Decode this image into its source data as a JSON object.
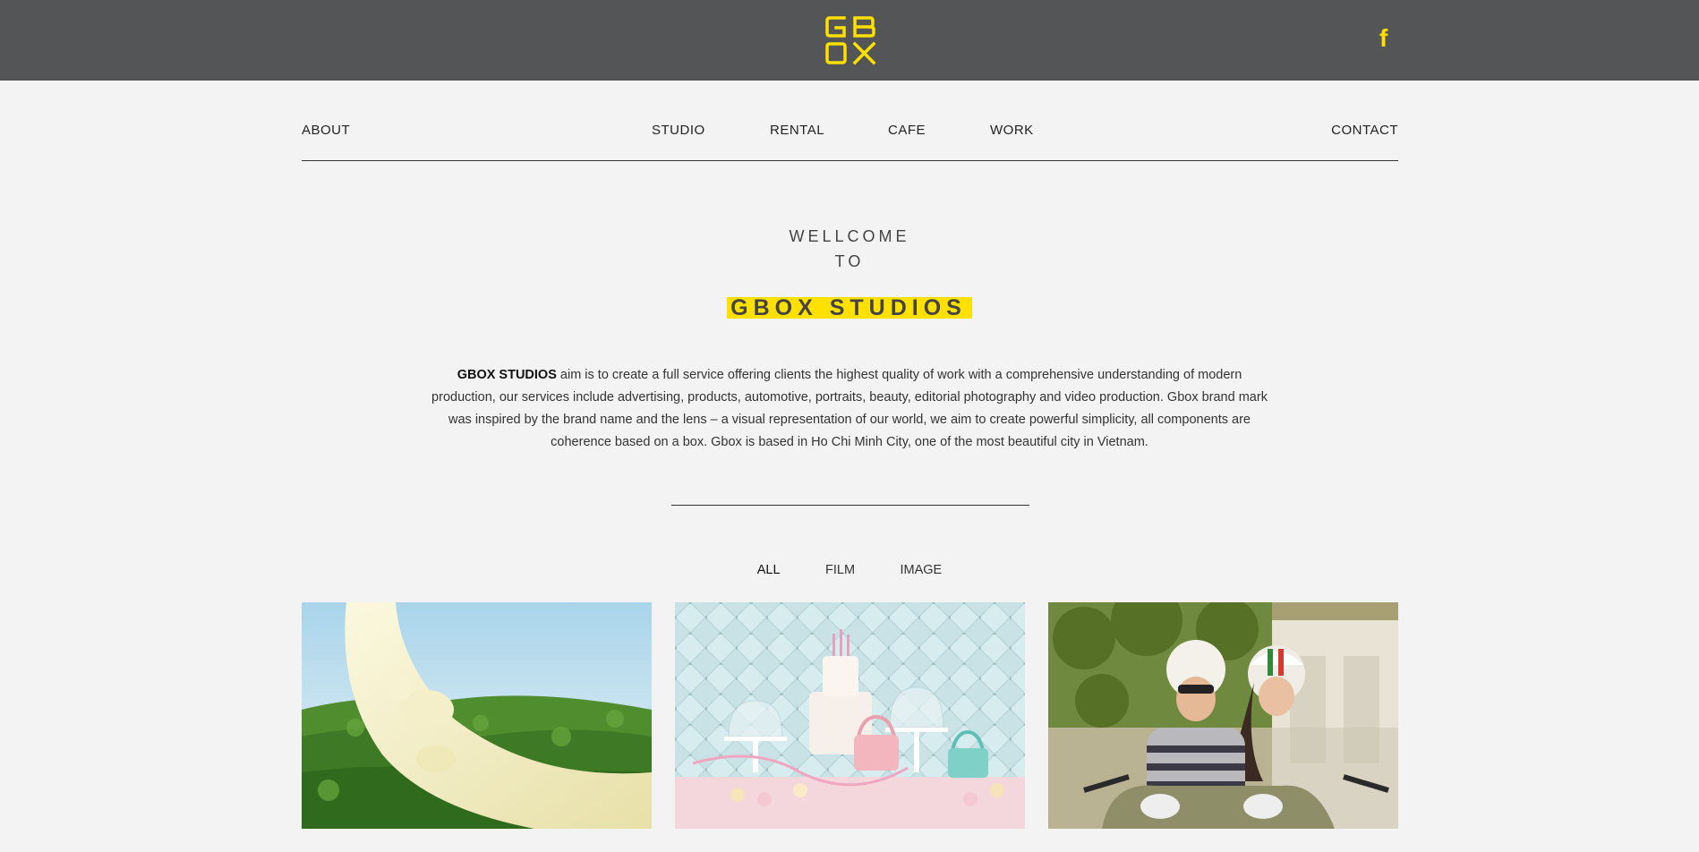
{
  "header": {
    "logo_text": "GB OX",
    "logo_color": "#ffe000",
    "background": "#545557",
    "social_icon": "facebook-icon"
  },
  "nav": {
    "about": "ABOUT",
    "studio": "STUDIO",
    "rental": "RENTAL",
    "cafe": "CAFE",
    "work": "WORK",
    "contact": "CONTACT"
  },
  "hero": {
    "line1": "WELLCOME",
    "line2": "TO",
    "brand": "GBOX STUDIOS",
    "highlight_color": "#ffe000",
    "description_lead": "GBOX STUDIOS",
    "description": " aim is to create a full service offering clients the highest quality of work with a comprehensive understanding of modern production, our services include advertising, products, automotive, portraits, beauty, editorial photography and video production. Gbox brand mark was inspired by the brand name and the lens – a visual representation of our world, we aim to create powerful simplicity, all components are coherence based on a box. Gbox is based in Ho Chi Minh City, one of the most beautiful city in Vietnam."
  },
  "filters": {
    "all": "ALL",
    "film": "FILM",
    "image": "IMAGE",
    "active": "ALL"
  },
  "portfolio": [
    {
      "subject": "milk splash over green tea field"
    },
    {
      "subject": "pastel cake and cupcake table set"
    },
    {
      "subject": "couple riding scooter with helmets"
    }
  ]
}
